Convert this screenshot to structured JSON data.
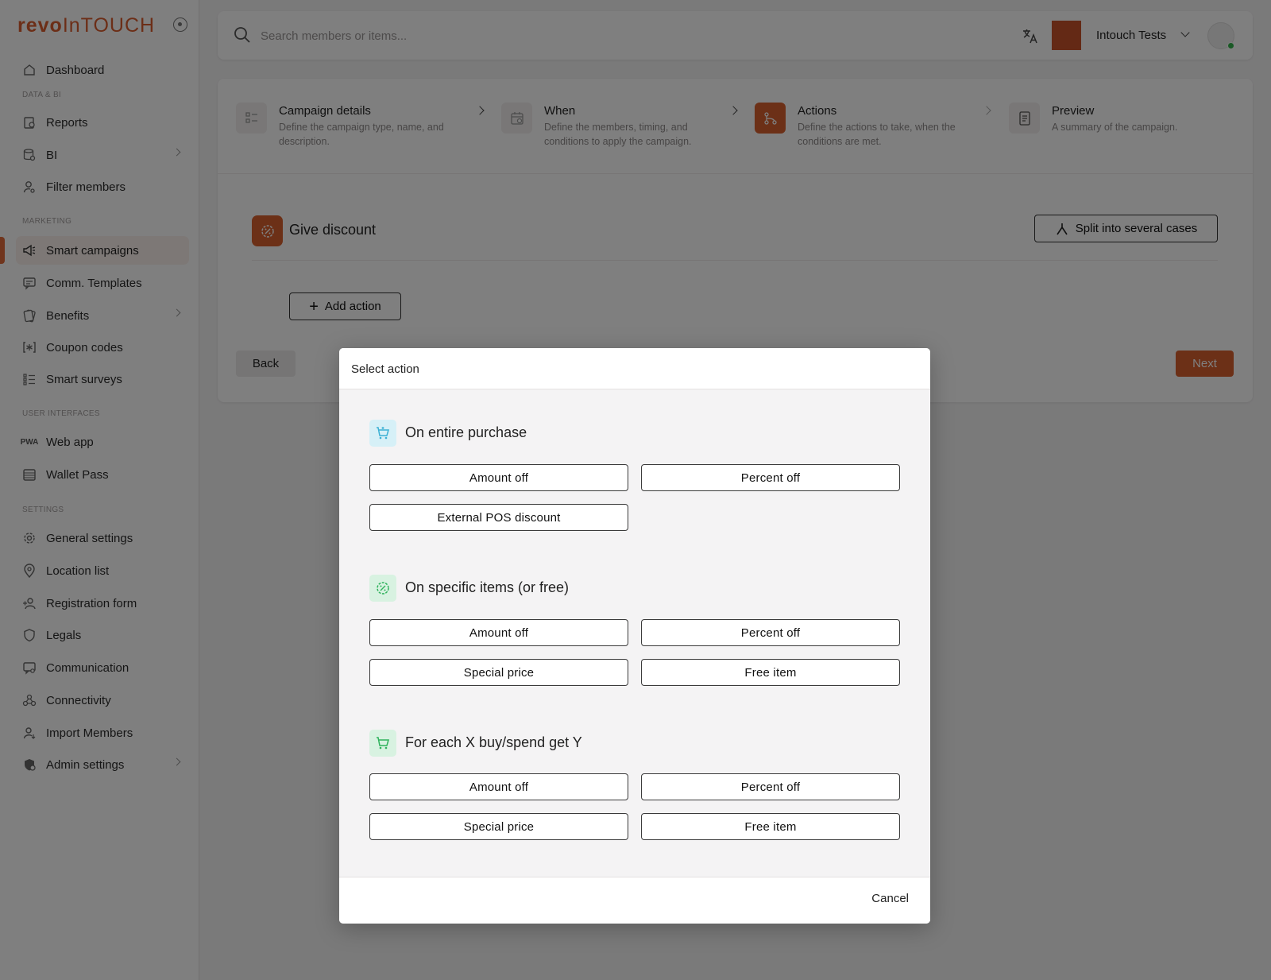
{
  "brand": {
    "logo_bold": "revo",
    "logo_light": "InTOUCH",
    "accent": "#d9602e"
  },
  "sidebar": {
    "items": [
      {
        "label": "Dashboard",
        "icon": "home-icon"
      },
      {
        "label": "Reports",
        "icon": "report-icon"
      },
      {
        "label": "BI",
        "icon": "database-icon"
      },
      {
        "label": "Filter members",
        "icon": "user-search-icon"
      },
      {
        "label": "Smart campaigns",
        "icon": "megaphone-icon"
      },
      {
        "label": "Comm. Templates",
        "icon": "message-icon"
      },
      {
        "label": "Benefits",
        "icon": "cards-icon"
      },
      {
        "label": "Coupon codes",
        "icon": "coupon-icon"
      },
      {
        "label": "Smart surveys",
        "icon": "list-icon"
      },
      {
        "label": "Web app",
        "icon": "pwa-icon"
      },
      {
        "label": "Wallet Pass",
        "icon": "wallet-icon"
      },
      {
        "label": "General settings",
        "icon": "gear-icon"
      },
      {
        "label": "Location list",
        "icon": "pin-icon"
      },
      {
        "label": "Registration form",
        "icon": "user-plus-icon"
      },
      {
        "label": "Legals",
        "icon": "shield-icon"
      },
      {
        "label": "Communication",
        "icon": "chat-icon"
      },
      {
        "label": "Connectivity",
        "icon": "webhook-icon"
      },
      {
        "label": "Import Members",
        "icon": "user-import-icon"
      },
      {
        "label": "Admin settings",
        "icon": "admin-icon"
      }
    ],
    "sections": {
      "data_bi": "DATA & BI",
      "marketing": "MARKETING",
      "user_interfaces": "USER INTERFACES",
      "settings": "SETTINGS"
    }
  },
  "topbar": {
    "search_placeholder": "Search members or items...",
    "org_name": "Intouch Tests"
  },
  "wizard": {
    "steps": [
      {
        "title": "Campaign details",
        "desc": "Define the campaign type, name, and description."
      },
      {
        "title": "When",
        "desc": "Define the members, timing, and conditions to apply the campaign."
      },
      {
        "title": "Actions",
        "desc": "Define the actions to take, when the conditions are met."
      },
      {
        "title": "Preview",
        "desc": "A summary of the campaign."
      }
    ],
    "active_step": "Actions"
  },
  "action_panel": {
    "title": "Give discount",
    "split_label": "Split into several cases",
    "add_action_label": "Add action",
    "back_label": "Back",
    "next_label": "Next"
  },
  "modal": {
    "title": "Select action",
    "groups": [
      {
        "title": "On entire purchase",
        "icon": "cart-sparkle-icon",
        "options": [
          "Amount off",
          "Percent off",
          "External POS discount"
        ]
      },
      {
        "title": "On specific items (or free)",
        "icon": "discount-badge-icon",
        "options": [
          "Amount off",
          "Percent off",
          "Special price",
          "Free item"
        ]
      },
      {
        "title": "For each X buy/spend get Y",
        "icon": "cart-icon",
        "options": [
          "Amount off",
          "Percent off",
          "Special price",
          "Free item"
        ]
      }
    ],
    "cancel_label": "Cancel"
  }
}
